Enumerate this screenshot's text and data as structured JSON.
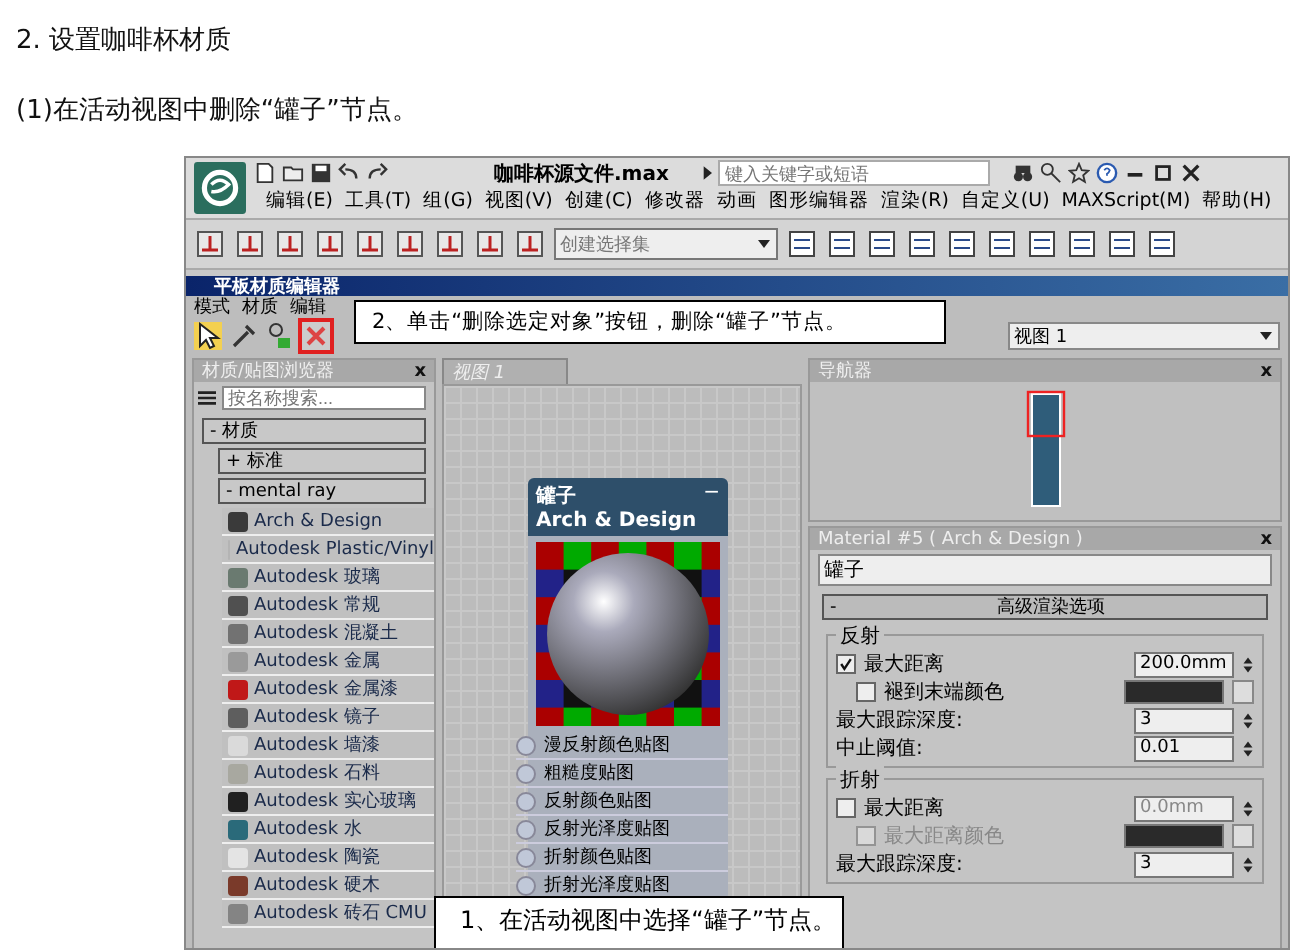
{
  "heading": "2. 设置咖啡杯材质",
  "instruction": "(1)在活动视图中删除“罐子”节点。",
  "app": {
    "title": "咖啡杯源文件.max",
    "search_placeholder": "键入关键字或短语",
    "menu": [
      "编辑(E)",
      "工具(T)",
      "组(G)",
      "视图(V)",
      "创建(C)",
      "修改器",
      "动画",
      "图形编辑器",
      "渲染(R)",
      "自定义(U)",
      "MAXScript(M)",
      "帮助(H)"
    ],
    "selection_set": "创建选择集"
  },
  "editor": {
    "title": "平板材质编辑器",
    "menu": [
      "模式",
      "材质",
      "编辑"
    ],
    "view_select": "视图 1",
    "callout": "2、单击“删除选定对象”按钮，删除“罐子”节点。",
    "browser": {
      "title": "材质/贴图浏览器",
      "close": "x",
      "search_placeholder": "按名称搜索...",
      "sections": [
        {
          "toggle": "-",
          "label": "材质"
        },
        {
          "toggle": "+",
          "label": "标准"
        },
        {
          "toggle": "-",
          "label": "mental ray"
        }
      ],
      "items": [
        {
          "label": "Arch & Design",
          "color": "#3a3a3a"
        },
        {
          "label": "Autodesk Plastic/Vinyl",
          "color": "#b4b4b4"
        },
        {
          "label": "Autodesk 玻璃",
          "color": "#6a7a70"
        },
        {
          "label": "Autodesk 常规",
          "color": "#505050"
        },
        {
          "label": "Autodesk 混凝土",
          "color": "#727272"
        },
        {
          "label": "Autodesk 金属",
          "color": "#9a9a9a"
        },
        {
          "label": "Autodesk 金属漆",
          "color": "#c01818"
        },
        {
          "label": "Autodesk 镜子",
          "color": "#5e5e5e"
        },
        {
          "label": "Autodesk 墙漆",
          "color": "#dadada"
        },
        {
          "label": "Autodesk 石料",
          "color": "#a8a8a0"
        },
        {
          "label": "Autodesk 实心玻璃",
          "color": "#202020"
        },
        {
          "label": "Autodesk 水",
          "color": "#2a6a7a"
        },
        {
          "label": "Autodesk 陶瓷",
          "color": "#e4e4e4"
        },
        {
          "label": "Autodesk 硬木",
          "color": "#7a3a2a"
        },
        {
          "label": "Autodesk 砖石 CMU",
          "color": "#848484"
        }
      ]
    },
    "view": {
      "tab": "视图 1",
      "node": {
        "title": "罐子",
        "subtitle": "Arch & Design",
        "collapse": "−",
        "slots": [
          "漫反射颜色贴图",
          "粗糙度贴图",
          "反射颜色贴图",
          "反射光泽度贴图",
          "折射颜色贴图",
          "折射光泽度贴图"
        ]
      },
      "callout": "1、在活动视图中选择“罐子”节点。"
    },
    "navigator": {
      "title": "导航器",
      "close": "x"
    },
    "material": {
      "title": "Material #5 ( Arch & Design )",
      "close": "x",
      "name": "罐子",
      "rollout": {
        "toggle": "-",
        "title": "高级渲染选项"
      },
      "groups": [
        {
          "title": "反射",
          "rows": [
            {
              "kind": "check",
              "label": "最大距离",
              "checked": true,
              "disabled": false,
              "value": "200.0mm"
            },
            {
              "kind": "color",
              "label": "褪到末端颜色",
              "checked": false,
              "disabled": false,
              "color": "#2a2a2a"
            },
            {
              "kind": "spinner",
              "label": "最大跟踪深度:",
              "value": "3"
            },
            {
              "kind": "spinner",
              "label": "中止阈值:",
              "value": "0.01"
            }
          ]
        },
        {
          "title": "折射",
          "rows": [
            {
              "kind": "check",
              "label": "最大距离",
              "checked": false,
              "disabled": false,
              "value": "0.0mm"
            },
            {
              "kind": "color",
              "label": "最大距离颜色",
              "checked": false,
              "disabled": true,
              "color": "#2a2a2a"
            },
            {
              "kind": "spinner",
              "label": "最大跟踪深度:",
              "value": "3"
            }
          ]
        }
      ]
    }
  }
}
